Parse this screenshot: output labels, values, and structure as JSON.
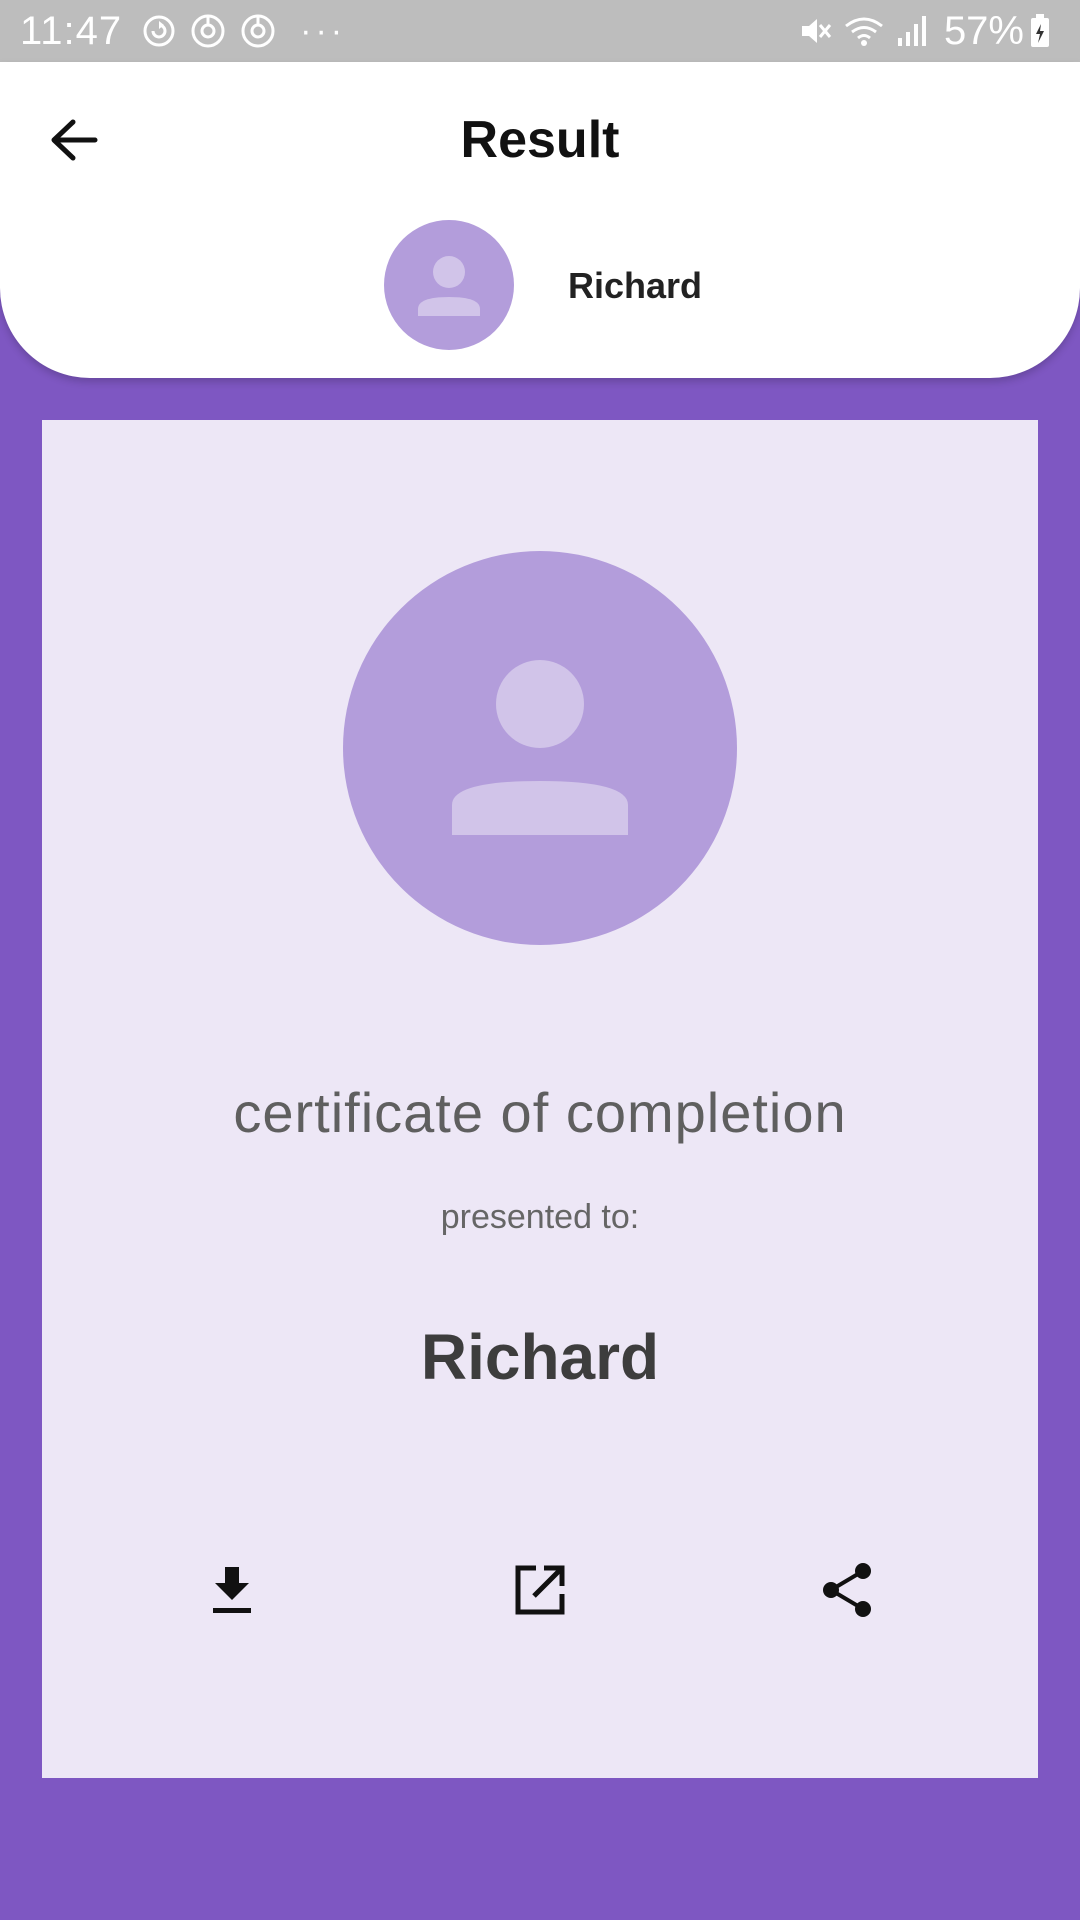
{
  "status_bar": {
    "time": "11:47",
    "battery": "57%",
    "icons": [
      "sync-icon",
      "location-icon",
      "location-icon",
      "more-dots-icon",
      "mute-icon",
      "wifi-icon",
      "signal-icon",
      "battery-charging-icon"
    ],
    "more": "···"
  },
  "header": {
    "title": "Result",
    "user_name": "Richard",
    "back_icon": "arrow-back-icon",
    "avatar_icon": "person-icon"
  },
  "certificate": {
    "title": "certificate of completion",
    "subtitle": "presented to:",
    "recipient": "Richard",
    "avatar_icon": "person-icon"
  },
  "actions": [
    {
      "name": "download",
      "icon": "download-icon"
    },
    {
      "name": "open",
      "icon": "open-in-new-icon"
    },
    {
      "name": "share",
      "icon": "share-icon"
    }
  ],
  "colors": {
    "background": "#7e57c2",
    "card": "#ede7f6",
    "avatar": "#b39ddb",
    "avatar_figure": "#d1c4e9",
    "status_bar": "#bdbdbd"
  }
}
